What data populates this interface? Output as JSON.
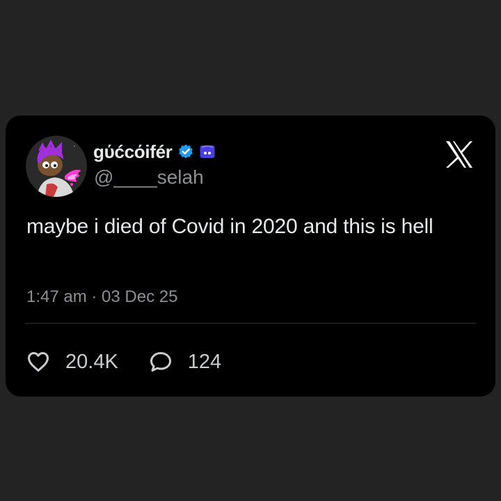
{
  "tweet": {
    "author": {
      "display_name": "gύćcόifér",
      "handle": "@____selah",
      "avatar_icon": "avatar-character-image",
      "verified_icon": "verified-badge-icon",
      "badge_icon": "bot-badge-icon"
    },
    "text": "maybe i died of Covid in 2020 and this is hell",
    "timestamp": "1:47 am · 03 Dec 25",
    "stats": {
      "likes": "20.4K",
      "replies": "124"
    },
    "platform_icon": "x-logo-icon"
  },
  "colors": {
    "page_background": "#232323",
    "card_background": "#000000",
    "primary_text": "#e7e9ea",
    "secondary_text": "#8b9095",
    "verified_blue": "#1d9bf0",
    "divider": "#2f3336"
  }
}
